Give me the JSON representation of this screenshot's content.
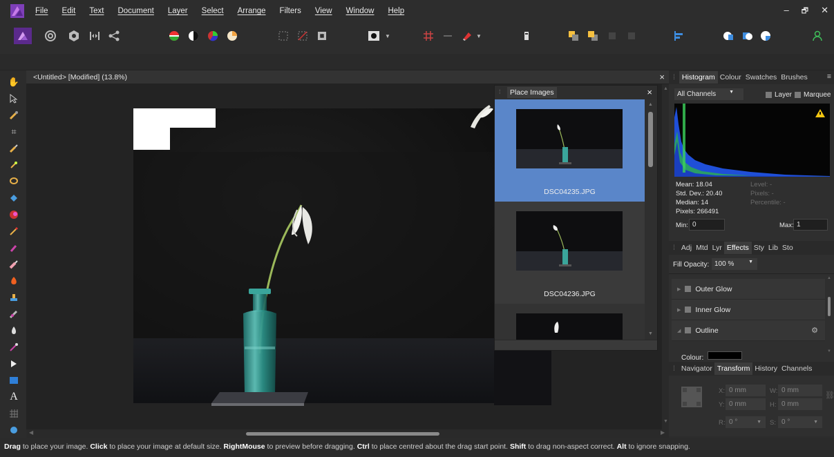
{
  "menu": {
    "items": [
      "File",
      "Edit",
      "Text",
      "Document",
      "Layer",
      "Select",
      "Arrange",
      "Filters",
      "View",
      "Window",
      "Help"
    ]
  },
  "window": {
    "minimize": "–",
    "restore": "🗗",
    "close": "✕"
  },
  "document": {
    "title": "<Untitled> [Modified] (13.8%)",
    "close": "×"
  },
  "place_images": {
    "title": "Place Images",
    "close": "×",
    "files": [
      "DSC04235.JPG",
      "DSC04236.JPG"
    ]
  },
  "histogram_panel": {
    "tabs": [
      "Histogram",
      "Colour",
      "Swatches",
      "Brushes"
    ],
    "channel": "All Channels",
    "layer_label": "Layer",
    "marquee_label": "Marquee",
    "stats": {
      "mean": "Mean: 18.04",
      "std_dev": "Std. Dev.: 20.40",
      "median": "Median: 14",
      "pixels": "Pixels: 266491"
    },
    "stats_dim": {
      "level": "Level: -",
      "pixels": "Pixels: -",
      "percentile": "Percentile: -"
    },
    "min_label": "Min:",
    "min_value": "0",
    "max_label": "Max:",
    "max_value": "1"
  },
  "effects_panel": {
    "tabs": [
      "Adj",
      "Mtd",
      "Lyr",
      "Effects",
      "Sty",
      "Lib",
      "Sto"
    ],
    "fill_opacity_label": "Fill Opacity:",
    "fill_opacity_value": "100 %",
    "effects": [
      "Outer Glow",
      "Inner Glow",
      "Outline"
    ],
    "colour_label": "Colour:",
    "colour_value": "#000000"
  },
  "transform_panel": {
    "tabs": [
      "Navigator",
      "Transform",
      "History",
      "Channels"
    ],
    "x_label": "X:",
    "x_value": "0 mm",
    "y_label": "Y:",
    "y_value": "0 mm",
    "w_label": "W:",
    "w_value": "0 mm",
    "h_label": "H:",
    "h_value": "0 mm",
    "r_label": "R:",
    "r_value": "0 °",
    "s_label": "S:",
    "s_value": "0 °"
  },
  "statusbar": {
    "drag": "Drag",
    "t1": " to place your image. ",
    "click": "Click",
    "t2": " to place your image at default size. ",
    "right": "RightMouse",
    "t3": " to preview before dragging. ",
    "ctrl": "Ctrl",
    "t4": " to place centred about the drag start point. ",
    "shift": "Shift",
    "t5": " to drag non-aspect correct. ",
    "alt": "Alt",
    "t6": " to ignore snapping."
  },
  "colors": {
    "accent": "#4f7fc8",
    "selected_thumb": "#5a86c9",
    "histogram_blue": "#1f4fd8",
    "histogram_green": "#2fbf3a",
    "warning": "#f2c511"
  }
}
